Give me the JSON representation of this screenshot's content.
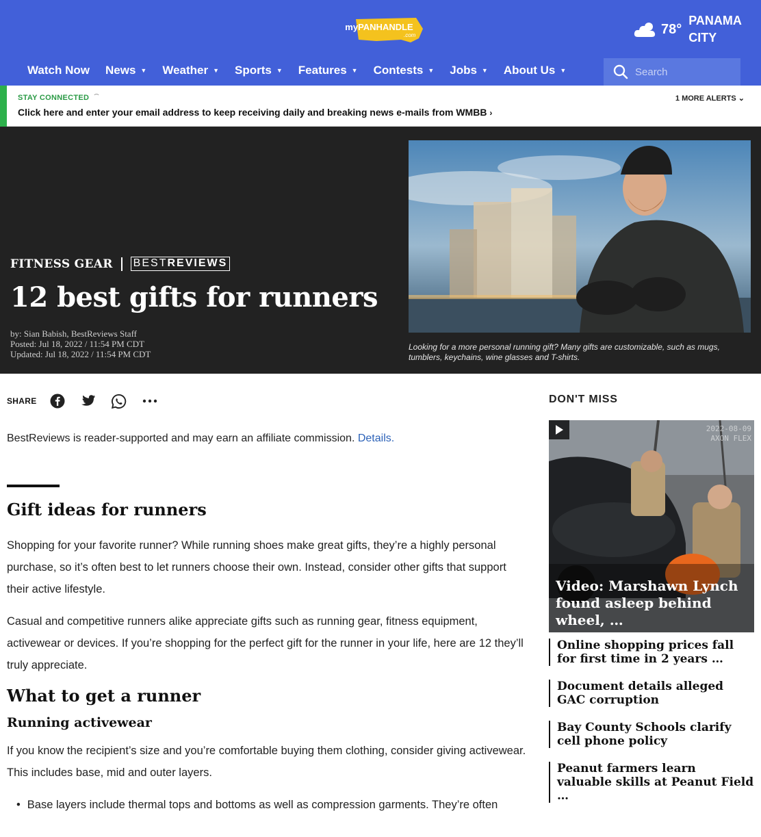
{
  "header": {
    "logo_text": "myPANHANDLE",
    "logo_suffix": ".com",
    "weather_temp": "78°",
    "weather_city": "PANAMA CITY",
    "weather_icon": "partly-cloudy-icon"
  },
  "nav": {
    "items": [
      {
        "label": "Watch Now"
      },
      {
        "label": "News",
        "caret": "▼"
      },
      {
        "label": "Weather",
        "caret": "▼"
      },
      {
        "label": "Sports",
        "caret": "▼"
      },
      {
        "label": "Features",
        "caret": "▼"
      },
      {
        "label": "Contests",
        "caret": "▼"
      },
      {
        "label": "Jobs",
        "caret": "▼"
      },
      {
        "label": "About Us",
        "caret": "▼"
      }
    ],
    "search_placeholder": "Search"
  },
  "alert": {
    "label": "STAY CONNECTED",
    "message": "Click here and enter your email address to keep receiving daily and breaking news e-mails from WMBB",
    "more": "1 MORE ALERTS"
  },
  "article": {
    "category": "FITNESS GEAR",
    "brand_a": "BEST",
    "brand_b": "REVIEWS",
    "title": "12 best gifts for runners",
    "byline": "by: Sian Babish, BestReviews Staff",
    "posted": "Posted: Jul 18, 2022 / 11:54 PM CDT",
    "updated": "Updated: Jul 18, 2022 / 11:54 PM CDT",
    "caption": "Looking for a more personal running gift? Many gifts are customizable, such as mugs, tumblers, keychains, wine glasses and T-shirts.",
    "share_label": "SHARE",
    "disclaimer": "BestReviews is reader-supported and may earn an affiliate commission.",
    "disclaimer_link": "Details.",
    "h_gift_ideas": "Gift ideas for runners",
    "p1": "Shopping for your favorite runner? While running shoes make great gifts, they’re a highly personal purchase, so it’s often best to let runners choose their own. Instead, consider other gifts that support their active lifestyle.",
    "p2": "Casual and competitive runners alike appreciate gifts such as running gear, fitness equipment, activewear or devices. If you’re shopping for the perfect gift for the runner in your life, here are 12 they’ll truly appreciate.",
    "h_what_to_get": "What to get a runner",
    "h_activewear": "Running activewear",
    "p3": "If you know the recipient’s size and you’re comfortable buying them clothing, consider giving activewear. This includes base, mid and outer layers.",
    "bullet1": "Base layers include thermal tops and bottoms as well as compression garments. They’re often"
  },
  "sidebar": {
    "title": "DON'T MISS",
    "feature_title": "Video: Marshawn Lynch found asleep behind wheel, …",
    "feature_stamp_date": "2022-08-09",
    "feature_stamp_cam": "AXON FLEX",
    "items": [
      {
        "title": "Online shopping prices fall for first time in 2 years …"
      },
      {
        "title": "Document details alleged GAC corruption"
      },
      {
        "title": "Bay County Schools clarify cell phone policy"
      },
      {
        "title": "Peanut farmers learn valuable skills at Peanut Field …"
      }
    ]
  },
  "colors": {
    "brand_blue": "#4260d9",
    "alert_green": "#2db04b",
    "hero_bg": "#222222",
    "link_blue": "#2c62b8"
  }
}
